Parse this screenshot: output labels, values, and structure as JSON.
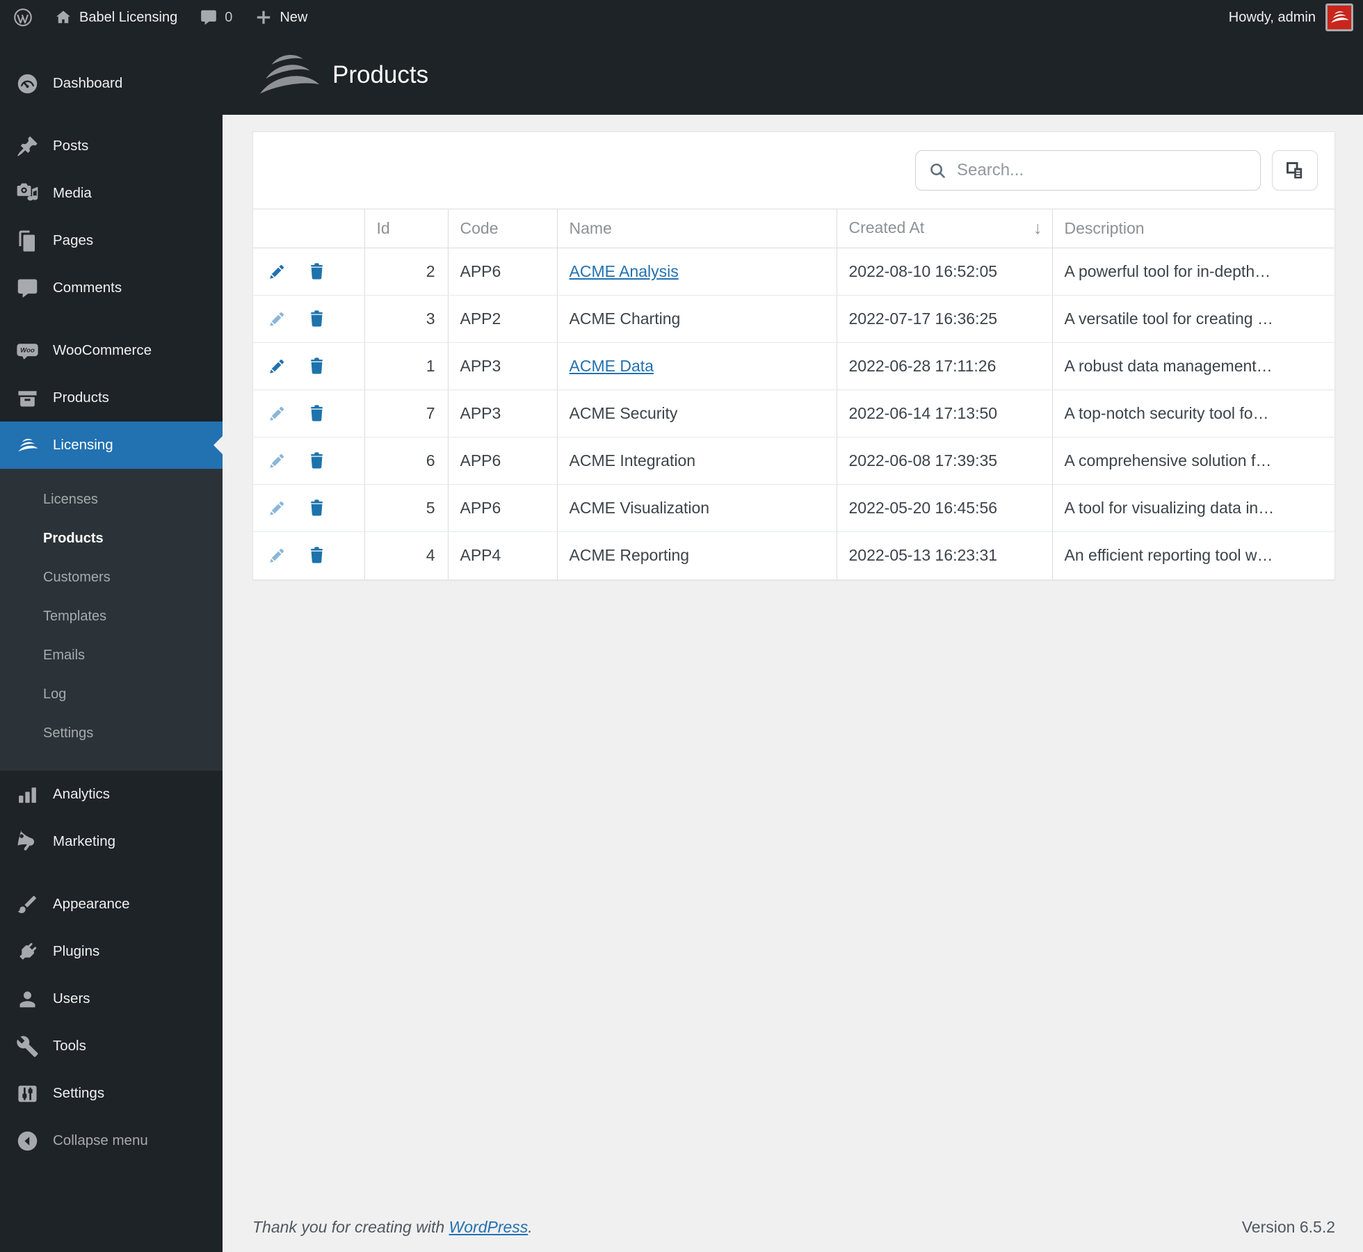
{
  "admin_bar": {
    "site_name": "Babel Licensing",
    "comments_count": "0",
    "new_label": "New",
    "howdy": "Howdy, admin"
  },
  "header": {
    "title": "Products"
  },
  "sidebar": {
    "items": [
      {
        "label": "Dashboard",
        "icon": "dashboard-icon"
      },
      {
        "label": "Posts",
        "icon": "pin-icon",
        "gap_before": true
      },
      {
        "label": "Media",
        "icon": "media-icon"
      },
      {
        "label": "Pages",
        "icon": "pages-icon"
      },
      {
        "label": "Comments",
        "icon": "comments-icon"
      },
      {
        "label": "WooCommerce",
        "icon": "woocommerce-icon",
        "gap_before": true
      },
      {
        "label": "Products",
        "icon": "products-box-icon"
      },
      {
        "label": "Licensing",
        "icon": "babel-logo-icon",
        "active": true,
        "submenu": [
          "Licenses",
          "Products",
          "Customers",
          "Templates",
          "Emails",
          "Log",
          "Settings"
        ],
        "submenu_current": "Products"
      },
      {
        "label": "Analytics",
        "icon": "analytics-icon"
      },
      {
        "label": "Marketing",
        "icon": "megaphone-icon"
      },
      {
        "label": "Appearance",
        "icon": "paintbrush-icon",
        "gap_before": true
      },
      {
        "label": "Plugins",
        "icon": "plug-icon"
      },
      {
        "label": "Users",
        "icon": "user-icon"
      },
      {
        "label": "Tools",
        "icon": "wrench-icon"
      },
      {
        "label": "Settings",
        "icon": "sliders-icon"
      },
      {
        "label": "Collapse menu",
        "icon": "collapse-icon",
        "dim": true
      }
    ]
  },
  "toolbar": {
    "search_placeholder": "Search..."
  },
  "table": {
    "columns": [
      {
        "key": "actions",
        "label": ""
      },
      {
        "key": "id",
        "label": "Id",
        "align": "right"
      },
      {
        "key": "code",
        "label": "Code"
      },
      {
        "key": "name",
        "label": "Name"
      },
      {
        "key": "created-at",
        "label": "Created At",
        "sorted": "desc"
      },
      {
        "key": "description",
        "label": "Description"
      }
    ],
    "rows": [
      {
        "id": "2",
        "code": "APP6",
        "name": "ACME Analysis",
        "name_link": true,
        "created_at": "2022-08-10 16:52:05",
        "description": "A powerful tool for in-depth…",
        "edit_active": true
      },
      {
        "id": "3",
        "code": "APP2",
        "name": "ACME Charting",
        "name_link": false,
        "created_at": "2022-07-17 16:36:25",
        "description": "A versatile tool for creating …",
        "edit_active": false
      },
      {
        "id": "1",
        "code": "APP3",
        "name": "ACME Data",
        "name_link": true,
        "created_at": "2022-06-28 17:11:26",
        "description": "A robust data management…",
        "edit_active": true
      },
      {
        "id": "7",
        "code": "APP3",
        "name": "ACME Security",
        "name_link": false,
        "created_at": "2022-06-14 17:13:50",
        "description": "A top-notch security tool fo…",
        "edit_active": false
      },
      {
        "id": "6",
        "code": "APP6",
        "name": "ACME Integration",
        "name_link": false,
        "created_at": "2022-06-08 17:39:35",
        "description": "A comprehensive solution f…",
        "edit_active": false
      },
      {
        "id": "5",
        "code": "APP6",
        "name": "ACME Visualization",
        "name_link": false,
        "created_at": "2022-05-20 16:45:56",
        "description": "A tool for visualizing data in…",
        "edit_active": false
      },
      {
        "id": "4",
        "code": "APP4",
        "name": "ACME Reporting",
        "name_link": false,
        "created_at": "2022-05-13 16:23:31",
        "description": "An efficient reporting tool w…",
        "edit_active": false
      }
    ]
  },
  "footer": {
    "thanks_prefix": "Thank you for creating with ",
    "wordpress_link": "WordPress",
    "thanks_suffix": ".",
    "version": "Version 6.5.2"
  },
  "colors": {
    "dark": "#1d2327",
    "submenu_bg": "#2c3338",
    "accent_blue": "#2271b1",
    "content_bg": "#f0f0f1",
    "link_blue": "#2271b1",
    "avatar_red": "#c9251c"
  }
}
